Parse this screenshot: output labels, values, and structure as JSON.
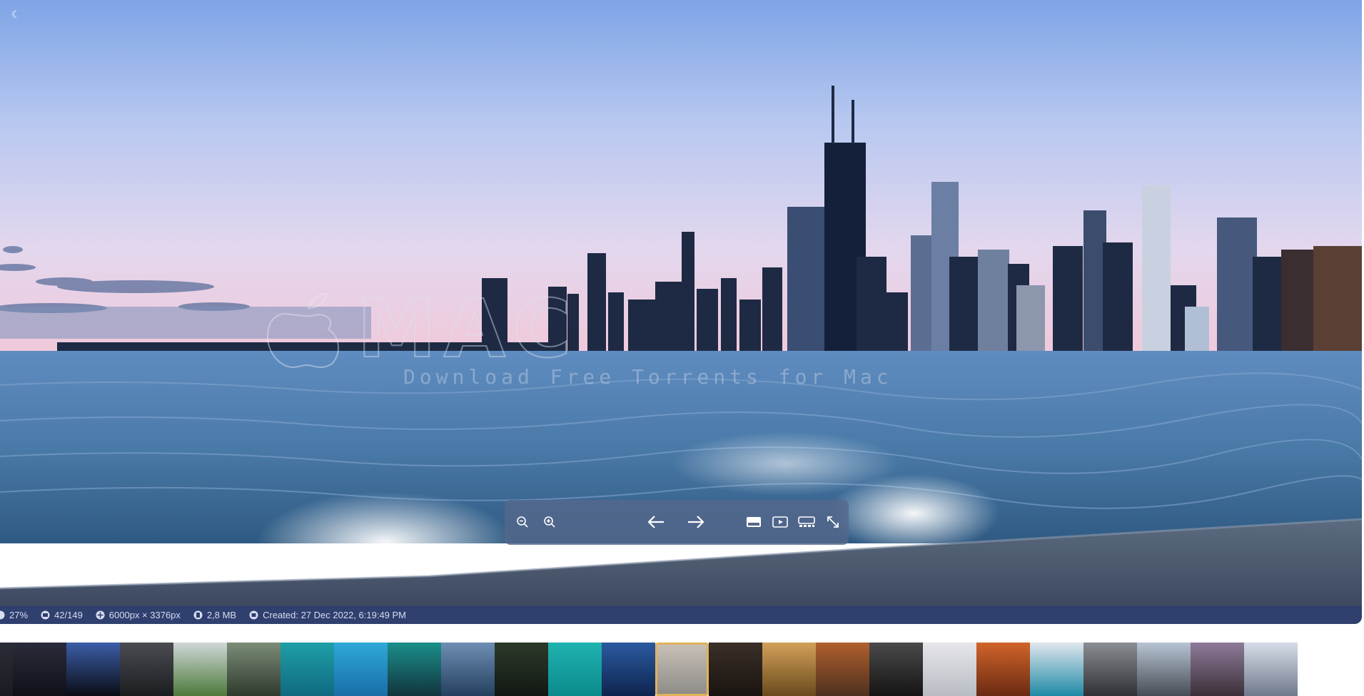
{
  "status_bar": {
    "zoom": "27%",
    "position": "42/149",
    "dimensions": "6000px × 3376px",
    "file_size": "2,8 MB",
    "created": "Created: 27 Dec 2022, 6:19:49 PM"
  },
  "watermark": {
    "logo_text": "MAC",
    "tagline": "Download Free Torrents for Mac"
  },
  "toolbar": {
    "buttons": [
      "zoom-out-icon",
      "zoom-in-icon",
      "previous-arrow-icon",
      "next-arrow-icon",
      "single-view-icon",
      "slideshow-icon",
      "filmstrip-icon",
      "fullscreen-icon"
    ]
  },
  "filmstrip": {
    "selected_index": 13,
    "thumbnails": [
      {
        "name": "dark-partial",
        "top": "#2b2d36",
        "bottom": "#1a1b22"
      },
      {
        "name": "night-sky",
        "top": "#2a2c3a",
        "bottom": "#0f1018"
      },
      {
        "name": "starburst",
        "top": "#3b5ea8",
        "bottom": "#0a0c14"
      },
      {
        "name": "dark-cave",
        "top": "#4a4c52",
        "bottom": "#1b1d20"
      },
      {
        "name": "green-mountain",
        "top": "#cfd7d8",
        "bottom": "#4d7a3a"
      },
      {
        "name": "waterfall",
        "top": "#7b8c78",
        "bottom": "#2f3b2c"
      },
      {
        "name": "aerial-island",
        "top": "#1f9fa8",
        "bottom": "#0f6a80"
      },
      {
        "name": "tropical-coast",
        "top": "#2ea8d8",
        "bottom": "#1a6ea8"
      },
      {
        "name": "aurora",
        "top": "#1b8f8a",
        "bottom": "#12343e"
      },
      {
        "name": "mountain-lake",
        "top": "#6f8eb4",
        "bottom": "#24405e"
      },
      {
        "name": "dark-forest",
        "top": "#2d3a2a",
        "bottom": "#111812"
      },
      {
        "name": "teal-harbor",
        "top": "#1fb3b0",
        "bottom": "#0c8a8c"
      },
      {
        "name": "city-night",
        "top": "#2b5aa0",
        "bottom": "#0e2550"
      },
      {
        "name": "chicago-skyline",
        "top": "#c9c2b8",
        "bottom": "#8d8a86"
      },
      {
        "name": "night-lights",
        "top": "#3a2f28",
        "bottom": "#1a1410"
      },
      {
        "name": "autumn-valley",
        "top": "#d2a15a",
        "bottom": "#6a4a1c"
      },
      {
        "name": "autumn-road",
        "top": "#b0602c",
        "bottom": "#4e3020"
      },
      {
        "name": "mono-texture",
        "top": "#4a4a4a",
        "bottom": "#141414"
      },
      {
        "name": "white-abstract",
        "top": "#e6e6ea",
        "bottom": "#b9bcc4"
      },
      {
        "name": "orange-path",
        "top": "#d0642a",
        "bottom": "#6a2a12"
      },
      {
        "name": "glacier-lake",
        "top": "#dfe6ec",
        "bottom": "#1f8aa6"
      },
      {
        "name": "grey-peaks",
        "top": "#8a8d92",
        "bottom": "#2e3136"
      },
      {
        "name": "alpine-range",
        "top": "#b8c4d4",
        "bottom": "#464c54"
      },
      {
        "name": "rocky-peak",
        "top": "#8e7a9a",
        "bottom": "#3a3038"
      },
      {
        "name": "snowy-mountain",
        "top": "#d6dde8",
        "bottom": "#6f7a8c"
      }
    ]
  }
}
